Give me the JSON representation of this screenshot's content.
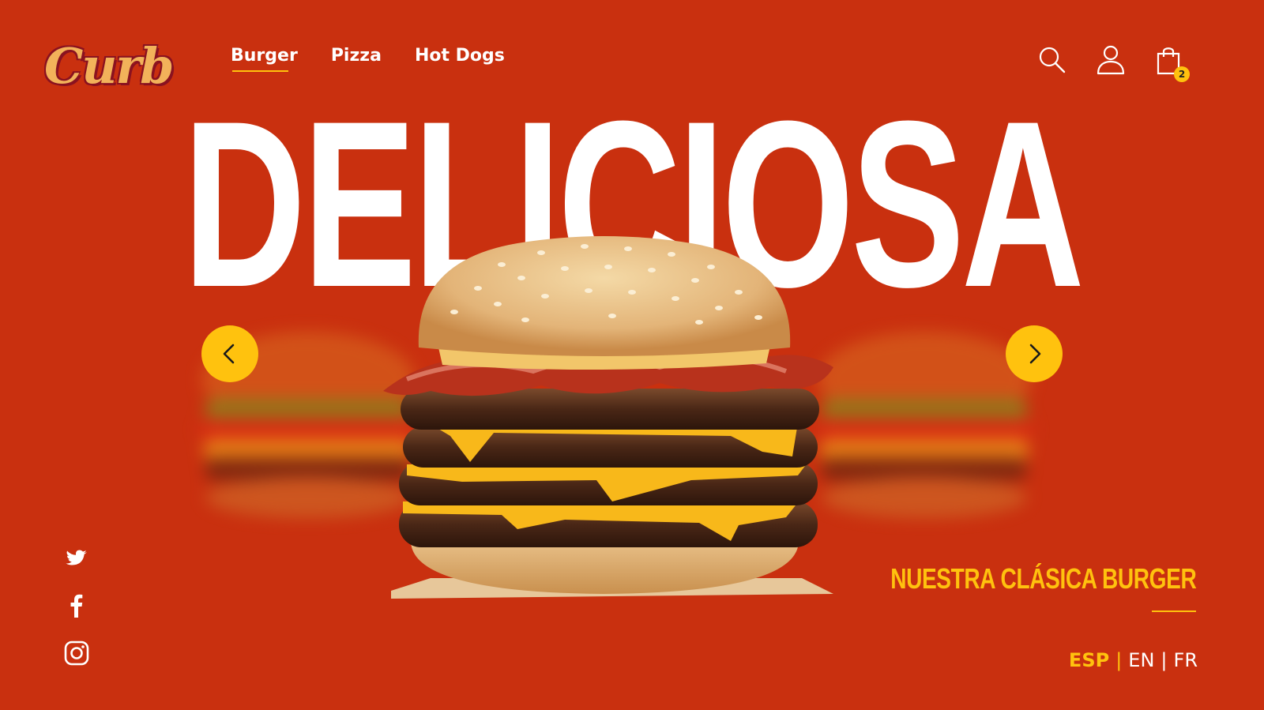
{
  "brand": {
    "logo_text": "Curb",
    "colors": {
      "background": "#c9300f",
      "accent": "#ffc20e",
      "text": "#ffffff",
      "logo_fill": "#f2b25a",
      "logo_outline": "#8a1220"
    }
  },
  "nav": {
    "items": [
      {
        "label": "Burger",
        "active": true
      },
      {
        "label": "Pizza",
        "active": false
      },
      {
        "label": "Hot Dogs",
        "active": false
      }
    ]
  },
  "header": {
    "icons": [
      "search-icon",
      "user-icon",
      "shopping-bag-icon"
    ],
    "cart_count": "2"
  },
  "hero": {
    "title": "DELICIOSA",
    "prev_icon": "chevron-left-icon",
    "next_icon": "chevron-right-icon"
  },
  "tagline": {
    "text": "NUESTRA CLÁSICA BURGER"
  },
  "social": {
    "icons": [
      "twitter-icon",
      "facebook-icon",
      "instagram-icon"
    ]
  },
  "language": {
    "items": [
      {
        "label": "ESP",
        "active": true
      },
      {
        "label": "EN",
        "active": false
      },
      {
        "label": "FR",
        "active": false
      }
    ],
    "separator": "|"
  }
}
